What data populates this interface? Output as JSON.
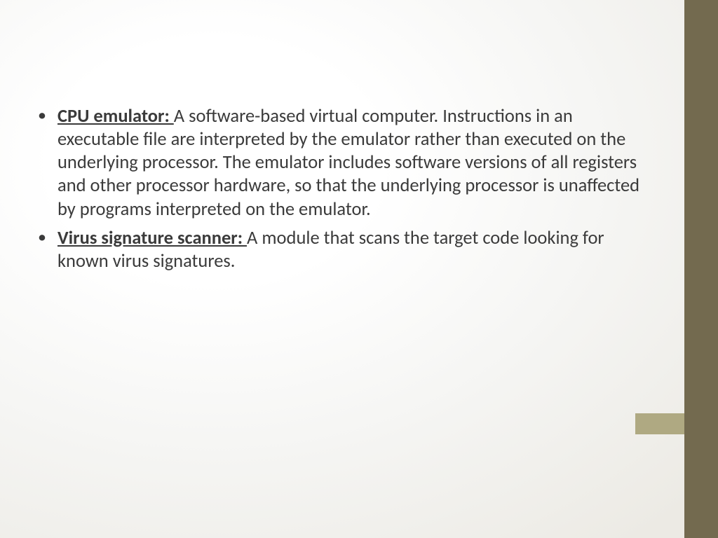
{
  "slide": {
    "bullets": [
      {
        "term": "CPU emulator: ",
        "description": "A software-based virtual computer. Instructions in an executable file are interpreted by the emulator rather than executed on the underlying processor. The emulator includes software versions of all registers and other processor hardware, so that the underlying processor is unaffected by programs interpreted on the emulator."
      },
      {
        "term": " Virus signature scanner: ",
        "description": "A module that scans the target code looking for known virus signatures."
      }
    ],
    "theme": {
      "sidebar_dark": "#736A4F",
      "sidebar_accent": "#AFA982",
      "text_color": "#3b3b3b"
    }
  }
}
